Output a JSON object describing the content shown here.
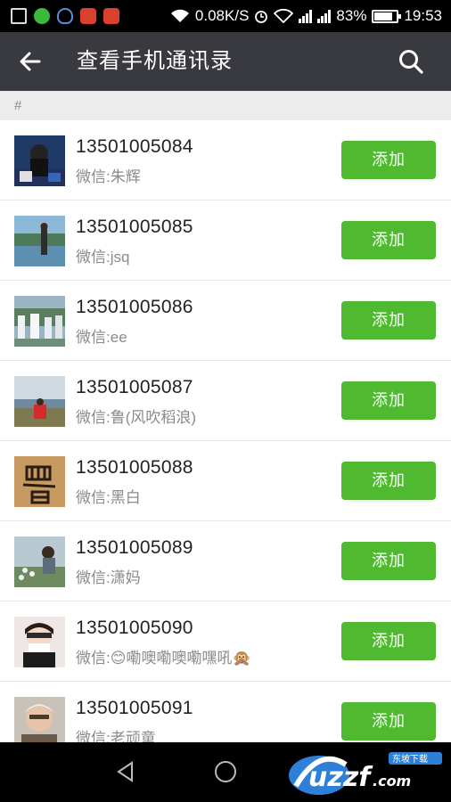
{
  "status_bar": {
    "net_speed": "0.08K/S",
    "battery": "83%",
    "battery_level": 0.83,
    "time": "19:53",
    "icons": [
      "image-icon",
      "green-app-icon",
      "qq-icon",
      "red-app-icon",
      "red-app-icon",
      "wifi-icon",
      "alarm-icon",
      "signal-icon",
      "battery-icon"
    ]
  },
  "header": {
    "title": "查看手机通讯录",
    "back_icon": "arrow-left-icon",
    "search_icon": "search-icon"
  },
  "section": {
    "label": "#"
  },
  "contacts": [
    {
      "phone": "13501005084",
      "wechat_prefix": "微信:",
      "wechat": "朱辉",
      "button": "添加"
    },
    {
      "phone": "13501005085",
      "wechat_prefix": "微信:",
      "wechat": "jsq",
      "button": "添加"
    },
    {
      "phone": "13501005086",
      "wechat_prefix": "微信:",
      "wechat": "ee",
      "button": "添加"
    },
    {
      "phone": "13501005087",
      "wechat_prefix": "微信:",
      "wechat": "鲁(风吹稻浪)",
      "button": "添加"
    },
    {
      "phone": "13501005088",
      "wechat_prefix": "微信:",
      "wechat": "黑白",
      "button": "添加"
    },
    {
      "phone": "13501005089",
      "wechat_prefix": "微信:",
      "wechat": "潇妈",
      "button": "添加"
    },
    {
      "phone": "13501005090",
      "wechat_prefix": "微信:",
      "wechat": "😊嘞噢嘞噢嘞嘿吼🙊",
      "button": "添加"
    },
    {
      "phone": "13501005091",
      "wechat_prefix": "微信:",
      "wechat": "老顽童",
      "button": "添加"
    }
  ],
  "watermark": {
    "text": "uzzf.com",
    "tag": "东坡下载"
  },
  "colors": {
    "header_bg": "#393a3f",
    "add_button": "#4fba30",
    "section_bg": "#ececec"
  }
}
